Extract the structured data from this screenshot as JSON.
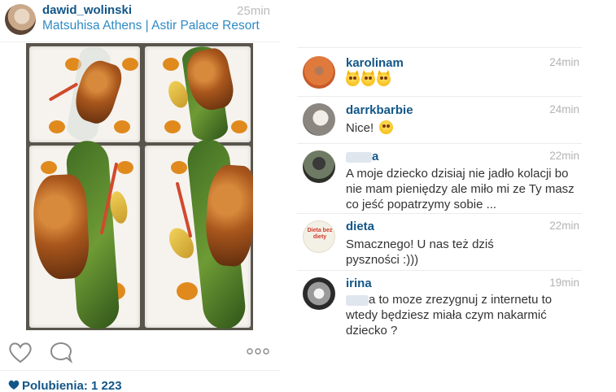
{
  "post": {
    "username": "dawid_wolinski",
    "time": "25min",
    "location": "Matsuhisa Athens | Astir Palace Resort",
    "likes_text": "Polubienia: 1 223",
    "icons": {
      "like": "heart-outline-icon",
      "comment": "speech-bubble-icon",
      "more": "ellipsis-icon",
      "likes": "heart-filled-icon"
    }
  },
  "comments": [
    {
      "username": "karolinam",
      "time": "24min",
      "text": "",
      "emoji": [
        "smiling-cat-emoji",
        "smiling-cat-emoji",
        "smiling-cat-emoji"
      ]
    },
    {
      "username": "darrkbarbie",
      "time": "24min",
      "text": "Nice!",
      "emoji": [
        "heart-eyes-emoji"
      ]
    },
    {
      "username_visible": "a",
      "time": "22min",
      "text": "A moje dziecko dzisiaj nie jadło kolacji bo nie mam pieniędzy ale miło mi ze Ty masz co jeść popatrzymy sobie ..."
    },
    {
      "username": "dieta",
      "time": "22min",
      "text": "Smacznego! U nas też dziś pyszności :)))",
      "avatar_text": "Dieta bez diety"
    },
    {
      "username": "irina",
      "time": "19min",
      "text_visible": "a  to moze zrezygnuj z internetu to wtedy będziesz miała czym nakarmić dziecko ?"
    }
  ],
  "colors": {
    "username": "#125688",
    "location": "#2f8ac4",
    "timestamp": "#b3b3b3",
    "divider": "#ececec"
  }
}
